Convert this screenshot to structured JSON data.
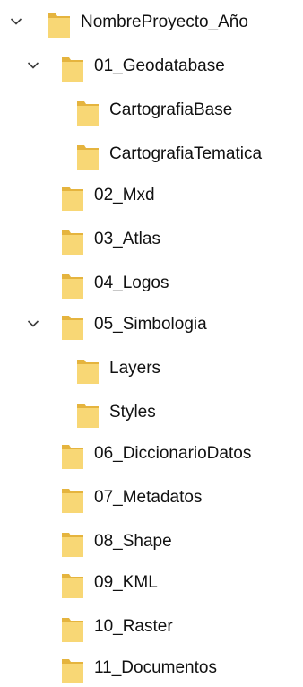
{
  "tree": {
    "items": [
      {
        "label": "NombreProyecto_Año",
        "expanded": true,
        "icon": "chevron-down-icon"
      },
      {
        "label": "01_Geodatabase",
        "expanded": true,
        "icon": "chevron-down-icon"
      },
      {
        "label": "CartografiaBase"
      },
      {
        "label": "CartografiaTematica"
      },
      {
        "label": "02_Mxd"
      },
      {
        "label": "03_Atlas"
      },
      {
        "label": "04_Logos"
      },
      {
        "label": "05_Simbologia",
        "expanded": true,
        "icon": "chevron-down-icon"
      },
      {
        "label": "Layers"
      },
      {
        "label": "Styles"
      },
      {
        "label": "06_DiccionarioDatos"
      },
      {
        "label": "07_Metadatos"
      },
      {
        "label": "08_Shape"
      },
      {
        "label": "09_KML"
      },
      {
        "label": "10_Raster"
      },
      {
        "label": "11_Documentos"
      }
    ]
  },
  "colors": {
    "folder_body": "#F8D775",
    "folder_tab": "#E5B43E",
    "chevron": "#3C3C3C",
    "text": "#111111"
  },
  "icons": {
    "folder": "folder-icon",
    "expand": "chevron-down-icon"
  }
}
